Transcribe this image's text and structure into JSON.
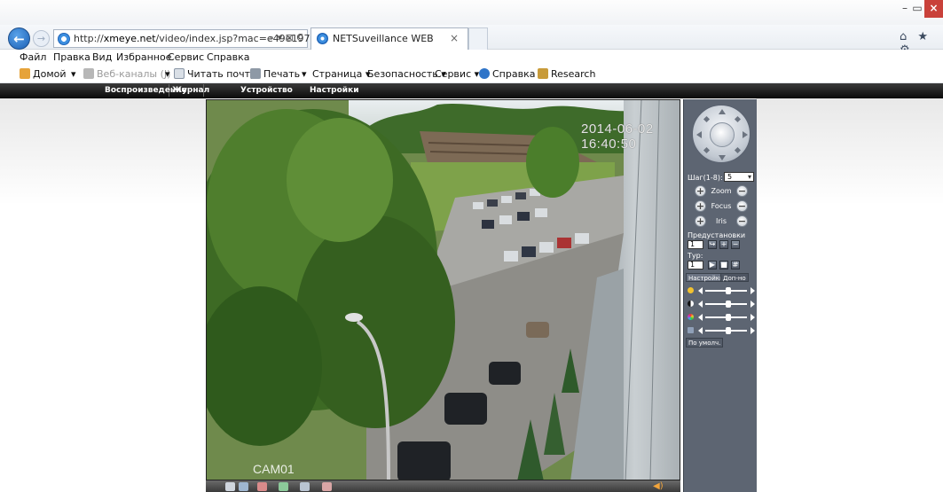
{
  "browser": {
    "url_prefix": "http://",
    "url_host": "xmeye.net",
    "url_path": "/video/index.jsp?mac=e49e1972ac",
    "url_actions": "⌕ ▾ ⊠ C",
    "tab_title": "NETSuveillance WEB",
    "tab_close": "×",
    "window_controls": {
      "minimize": "–",
      "maximize": "▭",
      "close": "×"
    },
    "right_icons": "⌂ ★ ⚙",
    "menu": [
      "Файл",
      "Правка",
      "Вид",
      "Избранное",
      "Сервис",
      "Справка"
    ],
    "favorites": {
      "home": "Домой",
      "feeds": "Веб-каналы (J)",
      "mail": "Читать почту",
      "print": "Печать",
      "page": "Страница ▾",
      "safety": "Безопасность ▾",
      "tools": "Сервис ▾",
      "help": "Справка ▾",
      "research": "Research",
      "dropdown_arrow": "▾"
    }
  },
  "app_nav": {
    "items": [
      "Воспроизведение",
      "Журнал",
      "Устройство",
      "Настройки"
    ]
  },
  "video": {
    "timestamp": "2014-06-02 16:40:50",
    "camera_label": "CAM01",
    "toolbar_icons": [
      "fullscreen-icon",
      "snapshot-icon",
      "record-icon",
      "open-folder-icon",
      "talk-icon",
      "stop-icon",
      "speaker-icon"
    ],
    "speaker_glyph": "◀)"
  },
  "ptz": {
    "step_label": "Шаг(1-8):",
    "step_value": "5",
    "zoom_label": "Zoom",
    "focus_label": "Focus",
    "iris_label": "Iris",
    "plus": "+",
    "minus": "−",
    "preset_label": "Предустановки",
    "preset_value": "1",
    "tour_label": "Тур:",
    "tour_value": "1",
    "tabs": [
      "Настройки",
      "Доп-но"
    ],
    "default_button": "По умолч.",
    "sliders": [
      {
        "name": "brightness",
        "color": "#f2c230",
        "level": 0.55
      },
      {
        "name": "contrast",
        "color": "#222222",
        "level": 0.55
      },
      {
        "name": "saturation",
        "color": "#c63ac4",
        "level": 0.55
      },
      {
        "name": "hue",
        "color": "#8fa0b8",
        "level": 0.55
      }
    ]
  }
}
